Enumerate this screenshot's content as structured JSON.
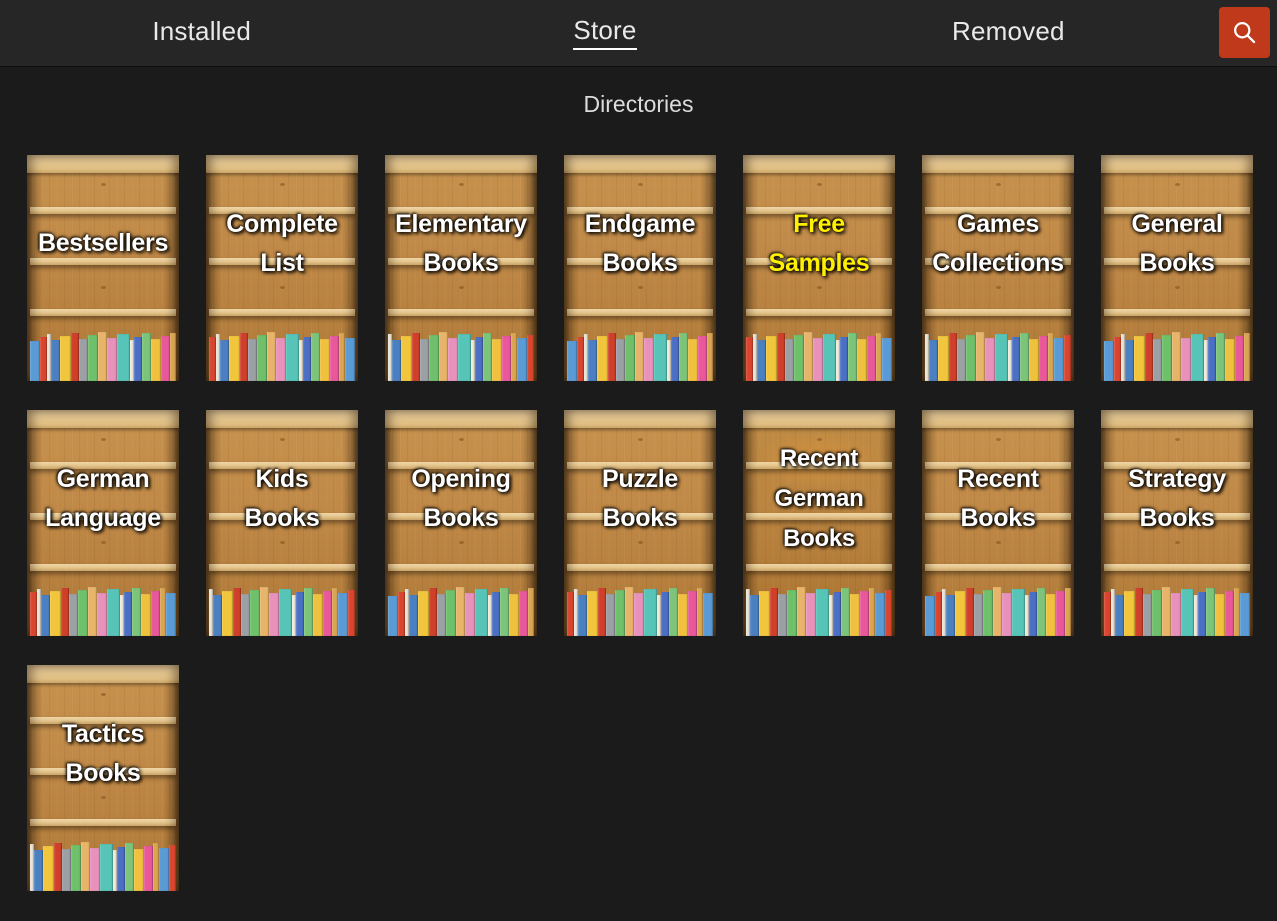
{
  "window": {
    "background_color": "#1b1b1b",
    "topbar_color": "#262626"
  },
  "topbar": {
    "tabs": [
      {
        "label": "Installed",
        "active": false
      },
      {
        "label": "Store",
        "active": true
      },
      {
        "label": "Removed",
        "active": false
      }
    ],
    "search_button": {
      "icon": "search-icon",
      "color": "#c0391b"
    }
  },
  "main": {
    "title": "Directories",
    "directories": [
      {
        "label": "Bestsellers",
        "lines": 1,
        "color": "#ffffff",
        "warm": false
      },
      {
        "label": "Complete\nList",
        "lines": 2,
        "color": "#ffffff",
        "warm": false
      },
      {
        "label": "Elementary\nBooks",
        "lines": 2,
        "color": "#ffffff",
        "warm": false
      },
      {
        "label": "Endgame\nBooks",
        "lines": 2,
        "color": "#ffffff",
        "warm": false
      },
      {
        "label": "Free\nSamples",
        "lines": 2,
        "color": "#ffef00",
        "warm": false
      },
      {
        "label": "Games\nCollections",
        "lines": 2,
        "color": "#ffffff",
        "warm": false
      },
      {
        "label": "General\nBooks",
        "lines": 2,
        "color": "#ffffff",
        "warm": false
      },
      {
        "label": "German\nLanguage",
        "lines": 2,
        "color": "#ffffff",
        "warm": false
      },
      {
        "label": "Kids\nBooks",
        "lines": 2,
        "color": "#ffffff",
        "warm": false
      },
      {
        "label": "Opening\nBooks",
        "lines": 2,
        "color": "#ffffff",
        "warm": false
      },
      {
        "label": "Puzzle\nBooks",
        "lines": 2,
        "color": "#ffffff",
        "warm": false
      },
      {
        "label": "Recent\nGerman\nBooks",
        "lines": 3,
        "color": "#ffffff",
        "warm": true
      },
      {
        "label": "Recent\nBooks",
        "lines": 2,
        "color": "#ffffff",
        "warm": false
      },
      {
        "label": "Strategy\nBooks",
        "lines": 2,
        "color": "#ffffff",
        "warm": false
      },
      {
        "label": "Tactics\nBooks",
        "lines": 2,
        "color": "#ffffff",
        "warm": false
      }
    ]
  },
  "artwork": {
    "book_spine_colors": [
      "#5b9bd5",
      "#d9452e",
      "#e8e4d8",
      "#4a7fc1",
      "#f2c63c",
      "#cf3f2a",
      "#9aa0a4",
      "#6ec06a",
      "#e8b46a",
      "#e892bb",
      "#56c4b6",
      "#efe9da",
      "#4a6fc4",
      "#7cc47a",
      "#f0c03f",
      "#e8589a",
      "#d9a551"
    ],
    "book_spine_widths": [
      10,
      7,
      4,
      9,
      11,
      8,
      9,
      10,
      9,
      10,
      13,
      4,
      8,
      9,
      10,
      9,
      6
    ],
    "wood_light": "#e7c992",
    "wood_mid": "#c7924e",
    "wood_dark": "#ad7837"
  }
}
